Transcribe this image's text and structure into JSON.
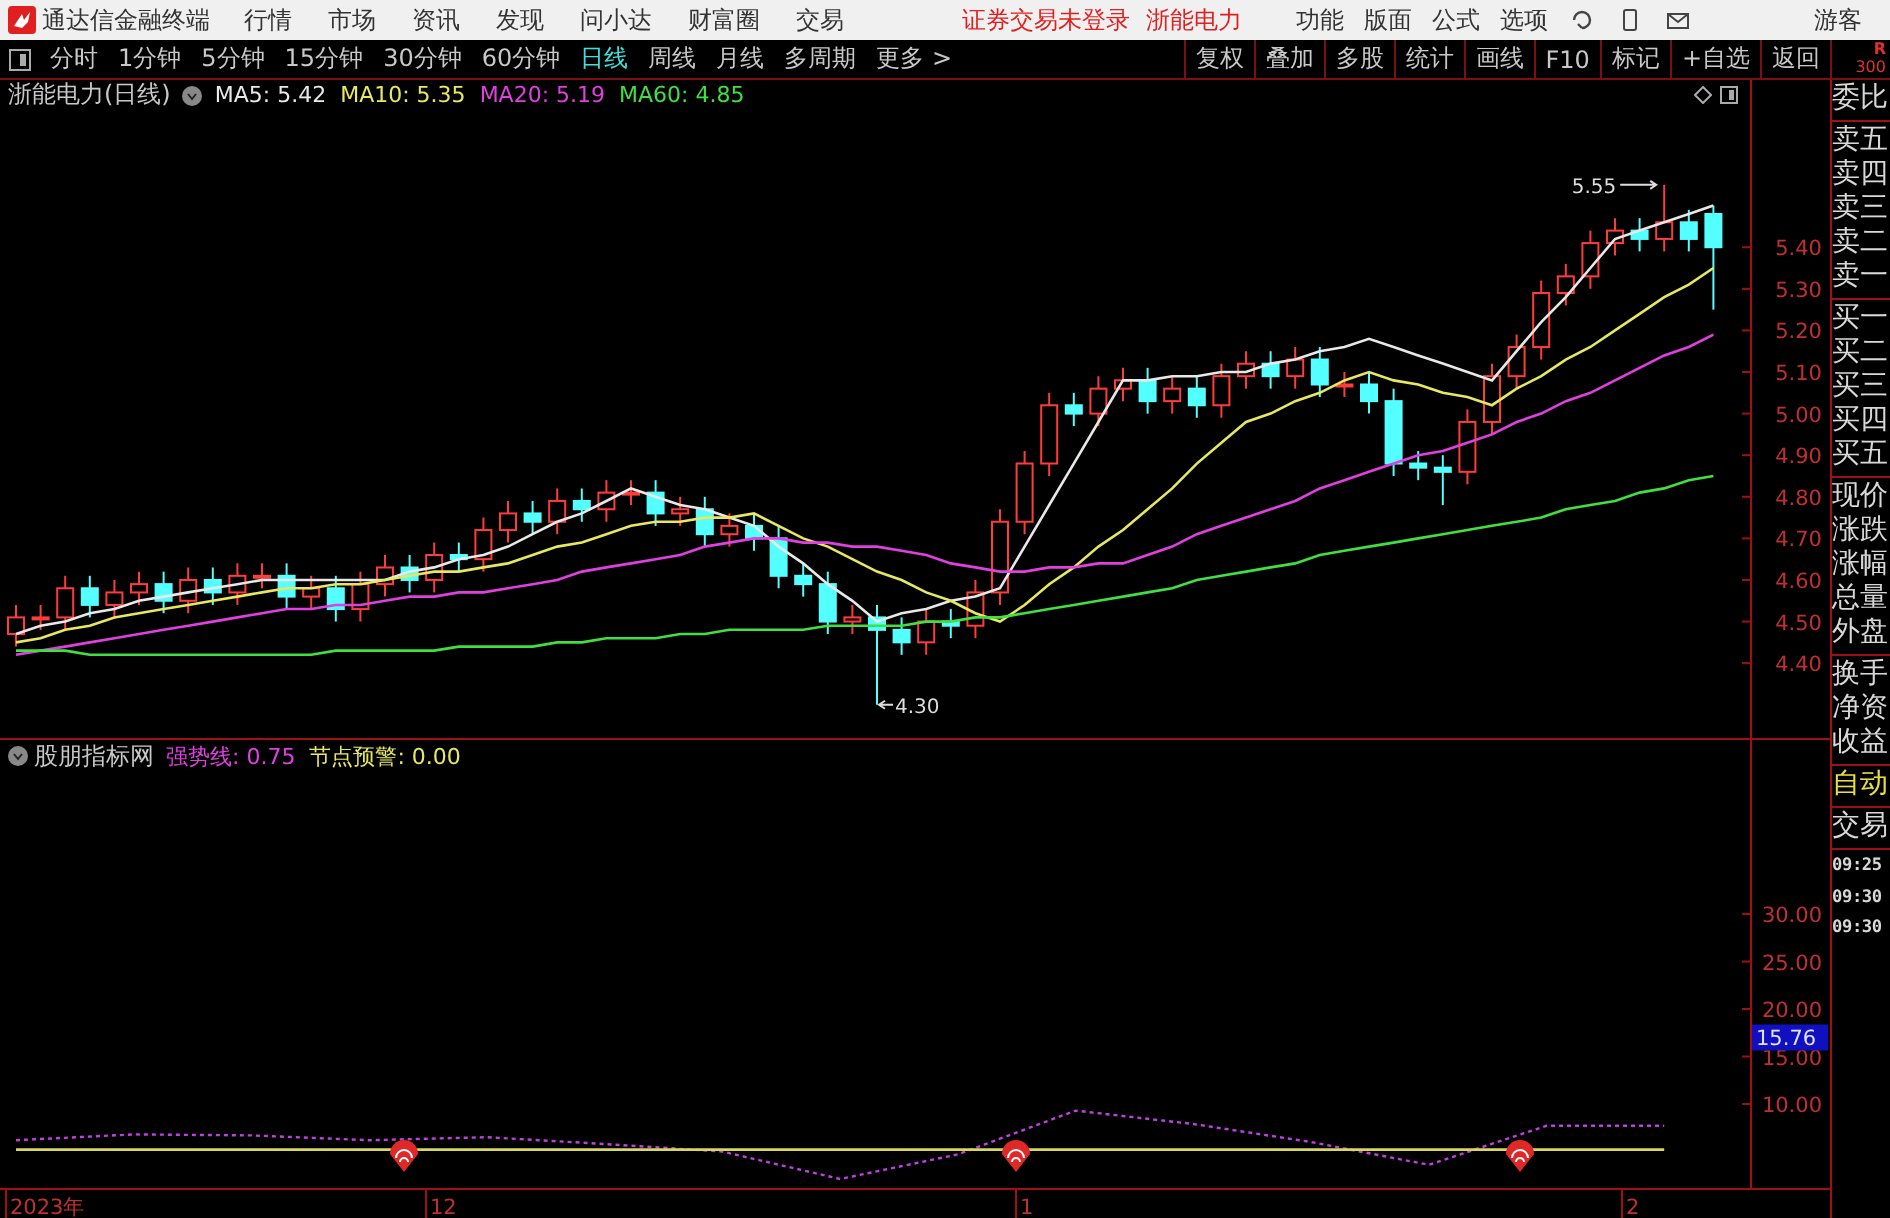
{
  "app": {
    "title": "通达信金融终端"
  },
  "menu": [
    "行情",
    "市场",
    "资讯",
    "发现",
    "问小达",
    "财富圈",
    "交易"
  ],
  "notices": [
    "证券交易未登录",
    "浙能电力"
  ],
  "right_menu": [
    "功能",
    "版面",
    "公式",
    "选项"
  ],
  "user": "游客",
  "periods": [
    {
      "label": "分时",
      "selected": false
    },
    {
      "label": "1分钟",
      "selected": false
    },
    {
      "label": "5分钟",
      "selected": false
    },
    {
      "label": "15分钟",
      "selected": false
    },
    {
      "label": "30分钟",
      "selected": false
    },
    {
      "label": "60分钟",
      "selected": false
    },
    {
      "label": "日线",
      "selected": true
    },
    {
      "label": "周线",
      "selected": false
    },
    {
      "label": "月线",
      "selected": false
    },
    {
      "label": "多周期",
      "selected": false
    },
    {
      "label": "更多 >",
      "selected": false
    }
  ],
  "tools": [
    "复权",
    "叠加",
    "多股",
    "统计",
    "画线",
    "F10",
    "标记",
    "+自选",
    "返回"
  ],
  "corner": {
    "line1": "R",
    "line2": "300"
  },
  "main_chart": {
    "title": "浙能电力(日线)",
    "ma": [
      {
        "label": "MA5: 5.42",
        "color": "#e8e8e8"
      },
      {
        "label": "MA10: 5.35",
        "color": "#e8e860"
      },
      {
        "label": "MA20: 5.19",
        "color": "#e040e0"
      },
      {
        "label": "MA60: 4.85",
        "color": "#40e040"
      }
    ],
    "high_label": "5.55",
    "low_label": "4.30",
    "chart_data": {
      "type": "candlestick",
      "categories": [
        null,
        null,
        null,
        null,
        null,
        null,
        null,
        null,
        null,
        null,
        null,
        null,
        null,
        null,
        null,
        null,
        null,
        null,
        null,
        null,
        null,
        null,
        null,
        null,
        null,
        null,
        null,
        null,
        null,
        null,
        null,
        null,
        null,
        null,
        null,
        null,
        null,
        null,
        null,
        null,
        null,
        null,
        null,
        null,
        null,
        null,
        null,
        null,
        null,
        null,
        null,
        null,
        null,
        null,
        null,
        null,
        null,
        null,
        null,
        null,
        null,
        null,
        null,
        null,
        null,
        null,
        null,
        null,
        null,
        null
      ],
      "ylim": [
        4.22,
        5.73
      ],
      "ohlc": [
        [
          4.47,
          4.54,
          4.44,
          4.51
        ],
        [
          4.51,
          4.54,
          4.48,
          4.51
        ],
        [
          4.51,
          4.61,
          4.48,
          4.58
        ],
        [
          4.58,
          4.61,
          4.51,
          4.54
        ],
        [
          4.54,
          4.6,
          4.51,
          4.57
        ],
        [
          4.57,
          4.62,
          4.54,
          4.59
        ],
        [
          4.59,
          4.62,
          4.52,
          4.55
        ],
        [
          4.55,
          4.63,
          4.52,
          4.6
        ],
        [
          4.6,
          4.63,
          4.54,
          4.57
        ],
        [
          4.57,
          4.64,
          4.54,
          4.61
        ],
        [
          4.61,
          4.64,
          4.58,
          4.61
        ],
        [
          4.61,
          4.64,
          4.53,
          4.56
        ],
        [
          4.56,
          4.61,
          4.53,
          4.58
        ],
        [
          4.58,
          4.61,
          4.5,
          4.53
        ],
        [
          4.53,
          4.62,
          4.5,
          4.59
        ],
        [
          4.59,
          4.66,
          4.56,
          4.63
        ],
        [
          4.63,
          4.66,
          4.57,
          4.6
        ],
        [
          4.6,
          4.69,
          4.57,
          4.66
        ],
        [
          4.66,
          4.69,
          4.62,
          4.65
        ],
        [
          4.65,
          4.75,
          4.62,
          4.72
        ],
        [
          4.72,
          4.79,
          4.69,
          4.76
        ],
        [
          4.76,
          4.79,
          4.71,
          4.74
        ],
        [
          4.74,
          4.82,
          4.71,
          4.79
        ],
        [
          4.79,
          4.82,
          4.74,
          4.77
        ],
        [
          4.77,
          4.84,
          4.74,
          4.81
        ],
        [
          4.81,
          4.84,
          4.78,
          4.81
        ],
        [
          4.81,
          4.84,
          4.73,
          4.76
        ],
        [
          4.76,
          4.8,
          4.73,
          4.77
        ],
        [
          4.77,
          4.8,
          4.68,
          4.71
        ],
        [
          4.71,
          4.76,
          4.68,
          4.73
        ],
        [
          4.73,
          4.76,
          4.67,
          4.7
        ],
        [
          4.7,
          4.73,
          4.58,
          4.61
        ],
        [
          4.61,
          4.64,
          4.56,
          4.59
        ],
        [
          4.59,
          4.62,
          4.47,
          4.5
        ],
        [
          4.5,
          4.54,
          4.47,
          4.51
        ],
        [
          4.51,
          4.54,
          4.3,
          4.48
        ],
        [
          4.48,
          4.51,
          4.42,
          4.45
        ],
        [
          4.45,
          4.53,
          4.42,
          4.5
        ],
        [
          4.5,
          4.53,
          4.46,
          4.49
        ],
        [
          4.49,
          4.6,
          4.46,
          4.57
        ],
        [
          4.57,
          4.77,
          4.54,
          4.74
        ],
        [
          4.74,
          4.91,
          4.71,
          4.88
        ],
        [
          4.88,
          5.05,
          4.85,
          5.02
        ],
        [
          5.02,
          5.05,
          4.97,
          5.0
        ],
        [
          5.0,
          5.09,
          4.97,
          5.06
        ],
        [
          5.06,
          5.11,
          5.03,
          5.08
        ],
        [
          5.08,
          5.11,
          5.0,
          5.03
        ],
        [
          5.03,
          5.09,
          5.0,
          5.06
        ],
        [
          5.06,
          5.09,
          4.99,
          5.02
        ],
        [
          5.02,
          5.12,
          4.99,
          5.09
        ],
        [
          5.09,
          5.15,
          5.06,
          5.12
        ],
        [
          5.12,
          5.15,
          5.06,
          5.09
        ],
        [
          5.09,
          5.16,
          5.06,
          5.13
        ],
        [
          5.13,
          5.16,
          5.04,
          5.07
        ],
        [
          5.07,
          5.1,
          5.04,
          5.07
        ],
        [
          5.07,
          5.1,
          5.0,
          5.03
        ],
        [
          5.03,
          5.06,
          4.85,
          4.88
        ],
        [
          4.88,
          4.91,
          4.84,
          4.87
        ],
        [
          4.87,
          4.9,
          4.78,
          4.86
        ],
        [
          4.86,
          5.01,
          4.83,
          4.98
        ],
        [
          4.98,
          5.12,
          4.95,
          5.09
        ],
        [
          5.09,
          5.19,
          5.06,
          5.16
        ],
        [
          5.16,
          5.32,
          5.13,
          5.29
        ],
        [
          5.29,
          5.36,
          5.26,
          5.33
        ],
        [
          5.33,
          5.44,
          5.3,
          5.41
        ],
        [
          5.41,
          5.47,
          5.38,
          5.44
        ],
        [
          5.44,
          5.47,
          5.39,
          5.42
        ],
        [
          5.42,
          5.55,
          5.39,
          5.46
        ],
        [
          5.46,
          5.49,
          5.39,
          5.42
        ],
        [
          5.48,
          5.5,
          5.25,
          5.4
        ]
      ],
      "yticks": [
        {
          "value": 5.4,
          "label": "5.40"
        },
        {
          "value": 5.3,
          "label": "5.30"
        },
        {
          "value": 5.2,
          "label": "5.20"
        },
        {
          "value": 5.1,
          "label": "5.10"
        },
        {
          "value": 5.0,
          "label": "5.00"
        },
        {
          "value": 4.9,
          "label": "4.90"
        },
        {
          "value": 4.8,
          "label": "4.80"
        },
        {
          "value": 4.7,
          "label": "4.70"
        },
        {
          "value": 4.6,
          "label": "4.60"
        },
        {
          "value": 4.5,
          "label": "4.50"
        },
        {
          "value": 4.4,
          "label": "4.40"
        }
      ],
      "series": [
        {
          "type": "line",
          "color": "#e8e8e8",
          "values": [
            4.47,
            4.49,
            4.5,
            4.52,
            4.53,
            4.55,
            4.56,
            4.57,
            4.58,
            4.59,
            4.6,
            4.6,
            4.6,
            4.6,
            4.6,
            4.6,
            4.62,
            4.63,
            4.65,
            4.66,
            4.68,
            4.71,
            4.74,
            4.76,
            4.79,
            4.82,
            4.8,
            4.78,
            4.77,
            4.75,
            4.73,
            4.68,
            4.64,
            4.59,
            4.55,
            4.5,
            4.52,
            4.53,
            4.55,
            4.56,
            4.58,
            4.68,
            4.78,
            4.88,
            4.98,
            5.08,
            5.08,
            5.09,
            5.09,
            5.1,
            5.1,
            5.12,
            5.13,
            5.15,
            5.16,
            5.18,
            5.16,
            5.14,
            5.12,
            5.1,
            5.08,
            5.15,
            5.22,
            5.28,
            5.35,
            5.42,
            5.44,
            5.46,
            5.48,
            5.5
          ]
        },
        {
          "type": "line",
          "color": "#e8e860",
          "values": [
            4.45,
            4.46,
            4.48,
            4.49,
            4.51,
            4.52,
            4.53,
            4.54,
            4.55,
            4.56,
            4.57,
            4.58,
            4.58,
            4.59,
            4.59,
            4.6,
            4.61,
            4.62,
            4.62,
            4.63,
            4.64,
            4.66,
            4.68,
            4.69,
            4.71,
            4.73,
            4.74,
            4.74,
            4.75,
            4.75,
            4.76,
            4.73,
            4.7,
            4.68,
            4.65,
            4.62,
            4.6,
            4.57,
            4.55,
            4.52,
            4.5,
            4.54,
            4.59,
            4.63,
            4.68,
            4.72,
            4.77,
            4.82,
            4.88,
            4.93,
            4.98,
            5.0,
            5.03,
            5.05,
            5.08,
            5.1,
            5.08,
            5.07,
            5.05,
            5.04,
            5.02,
            5.06,
            5.09,
            5.13,
            5.16,
            5.2,
            5.24,
            5.28,
            5.31,
            5.35
          ]
        },
        {
          "type": "line",
          "color": "#e040e0",
          "values": [
            4.42,
            4.43,
            4.44,
            4.45,
            4.46,
            4.47,
            4.48,
            4.49,
            4.5,
            4.51,
            4.52,
            4.53,
            4.53,
            4.54,
            4.54,
            4.55,
            4.56,
            4.56,
            4.57,
            4.57,
            4.58,
            4.59,
            4.6,
            4.62,
            4.63,
            4.64,
            4.65,
            4.66,
            4.68,
            4.69,
            4.7,
            4.7,
            4.69,
            4.69,
            4.68,
            4.68,
            4.67,
            4.66,
            4.64,
            4.63,
            4.62,
            4.62,
            4.63,
            4.63,
            4.64,
            4.64,
            4.66,
            4.68,
            4.71,
            4.73,
            4.75,
            4.77,
            4.79,
            4.82,
            4.84,
            4.86,
            4.88,
            4.9,
            4.91,
            4.93,
            4.95,
            4.98,
            5.0,
            5.03,
            5.05,
            5.08,
            5.11,
            5.14,
            5.16,
            5.19
          ]
        },
        {
          "type": "line",
          "color": "#40e040",
          "values": [
            4.43,
            4.43,
            4.43,
            4.42,
            4.42,
            4.42,
            4.42,
            4.42,
            4.42,
            4.42,
            4.42,
            4.42,
            4.42,
            4.43,
            4.43,
            4.43,
            4.43,
            4.43,
            4.44,
            4.44,
            4.44,
            4.44,
            4.45,
            4.45,
            4.46,
            4.46,
            4.46,
            4.47,
            4.47,
            4.48,
            4.48,
            4.48,
            4.48,
            4.49,
            4.49,
            4.49,
            4.49,
            4.5,
            4.5,
            4.51,
            4.51,
            4.52,
            4.53,
            4.54,
            4.55,
            4.56,
            4.57,
            4.58,
            4.6,
            4.61,
            4.62,
            4.63,
            4.64,
            4.66,
            4.67,
            4.68,
            4.69,
            4.7,
            4.71,
            4.72,
            4.73,
            4.74,
            4.75,
            4.77,
            4.78,
            4.79,
            4.81,
            4.82,
            4.84,
            4.85
          ]
        }
      ]
    }
  },
  "indicator": {
    "name": "股朋指标网",
    "current": "15.76",
    "values": [
      {
        "label": "强势线: 0.75",
        "color": "#e040e0"
      },
      {
        "label": "节点预警: 0.00",
        "color": "#e8e860"
      }
    ],
    "chart_data": {
      "type": "line",
      "categories": [
        null,
        null,
        null,
        null,
        null,
        null,
        null,
        null,
        null,
        null,
        null,
        null,
        null,
        null,
        null
      ],
      "ylim": [
        1.16,
        44.95
      ],
      "yticks": [
        {
          "value": 30,
          "label": "30.00"
        },
        {
          "value": 25,
          "label": "25.00"
        },
        {
          "value": 20,
          "label": "20.00"
        },
        {
          "value": 15,
          "label": "15.00"
        },
        {
          "value": 10,
          "label": "10.00"
        }
      ],
      "series": [
        {
          "color": "#c040e0",
          "line_style": "dashed",
          "values": [
            6.2,
            6.8,
            6.7,
            6.2,
            6.5,
            5.8,
            5.0,
            2.1,
            4.7,
            9.3,
            7.9,
            6.0,
            3.6,
            7.7,
            7.7
          ]
        },
        {
          "color": "#d8d860",
          "line_style": "solid",
          "values": [
            5.2,
            5.2,
            5.2,
            5.2,
            5.2,
            5.2,
            5.2,
            5.2,
            5.2,
            5.2,
            5.2,
            5.2,
            5.2,
            5.2,
            5.2
          ]
        }
      ]
    }
  },
  "date_axis": [
    "2023年",
    "12",
    "1",
    "2"
  ],
  "side_panel": {
    "groups": [
      {
        "items": [
          {
            "label": "委比",
            "kind": "field"
          }
        ]
      },
      {
        "items": [
          {
            "label": "卖五",
            "kind": "field"
          },
          {
            "label": "卖四",
            "kind": "field"
          },
          {
            "label": "卖三",
            "kind": "field"
          },
          {
            "label": "卖二",
            "kind": "field"
          },
          {
            "label": "卖一",
            "kind": "field"
          }
        ]
      },
      {
        "items": [
          {
            "label": "买一",
            "kind": "field"
          },
          {
            "label": "买二",
            "kind": "field"
          },
          {
            "label": "买三",
            "kind": "field"
          },
          {
            "label": "买四",
            "kind": "field"
          },
          {
            "label": "买五",
            "kind": "field"
          }
        ]
      },
      {
        "items": [
          {
            "label": "现价",
            "kind": "field"
          },
          {
            "label": "涨跌",
            "kind": "field"
          },
          {
            "label": "涨幅",
            "kind": "field"
          },
          {
            "label": "总量",
            "kind": "field"
          },
          {
            "label": "外盘",
            "kind": "field"
          }
        ]
      },
      {
        "items": [
          {
            "label": "换手",
            "kind": "field"
          },
          {
            "label": "净资",
            "kind": "field"
          },
          {
            "label": "收益",
            "kind": "field"
          }
        ]
      },
      {
        "items": [
          {
            "label": "自动",
            "kind": "tab"
          }
        ]
      },
      {
        "items": [
          {
            "label": "交易",
            "kind": "field"
          }
        ]
      },
      {
        "items": [
          {
            "label": "09:25",
            "kind": "time"
          },
          {
            "label": "09:30",
            "kind": "time"
          },
          {
            "label": "09:30",
            "kind": "time"
          }
        ]
      }
    ]
  }
}
